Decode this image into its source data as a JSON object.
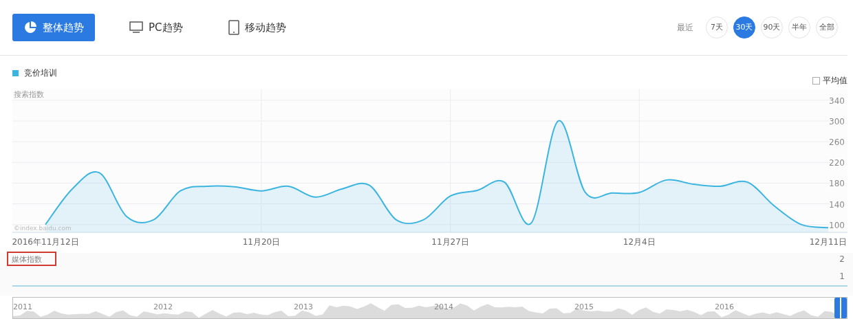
{
  "view_tabs": [
    {
      "label": "整体趋势",
      "selected": true
    },
    {
      "label": "PC趋势",
      "selected": false
    },
    {
      "label": "移动趋势",
      "selected": false
    }
  ],
  "range": {
    "label": "最近",
    "options": [
      {
        "label": "7天",
        "selected": false
      },
      {
        "label": "30天",
        "selected": true
      },
      {
        "label": "90天",
        "selected": false
      },
      {
        "label": "半年",
        "selected": false
      },
      {
        "label": "全部",
        "selected": false
      }
    ]
  },
  "average_toggle": {
    "label": "平均值",
    "checked": false
  },
  "search_index": {
    "title": "搜索指数",
    "credit": "©index.baidu.com",
    "chart_data": {
      "type": "area",
      "categories": [
        "2016年11月12日",
        null,
        null,
        null,
        null,
        null,
        null,
        null,
        "11月20日",
        null,
        null,
        null,
        null,
        null,
        null,
        "11月27日",
        null,
        null,
        null,
        null,
        null,
        null,
        "12月4日",
        null,
        null,
        null,
        null,
        null,
        null,
        "12月11日"
      ],
      "series": [
        {
          "name": "竞价培训",
          "color": "#3bb4e0",
          "values": [
            100,
            169,
            200,
            116,
            109,
            165,
            174,
            173,
            165,
            174,
            153,
            169,
            176,
            109,
            109,
            155,
            166,
            182,
            103,
            300,
            162,
            161,
            162,
            186,
            178,
            174,
            182,
            136,
            100,
            94
          ]
        }
      ],
      "ylim": [
        85,
        361
      ],
      "grid": true,
      "yticks": [
        100,
        140,
        180,
        220,
        260,
        300,
        340
      ]
    }
  },
  "media_index": {
    "title": "媒体指数",
    "highlighted": true,
    "ticks": [
      "2",
      "1"
    ]
  },
  "navigator": {
    "years": [
      "2011",
      "2012",
      "2013",
      "2014",
      "2015",
      "2016"
    ]
  }
}
